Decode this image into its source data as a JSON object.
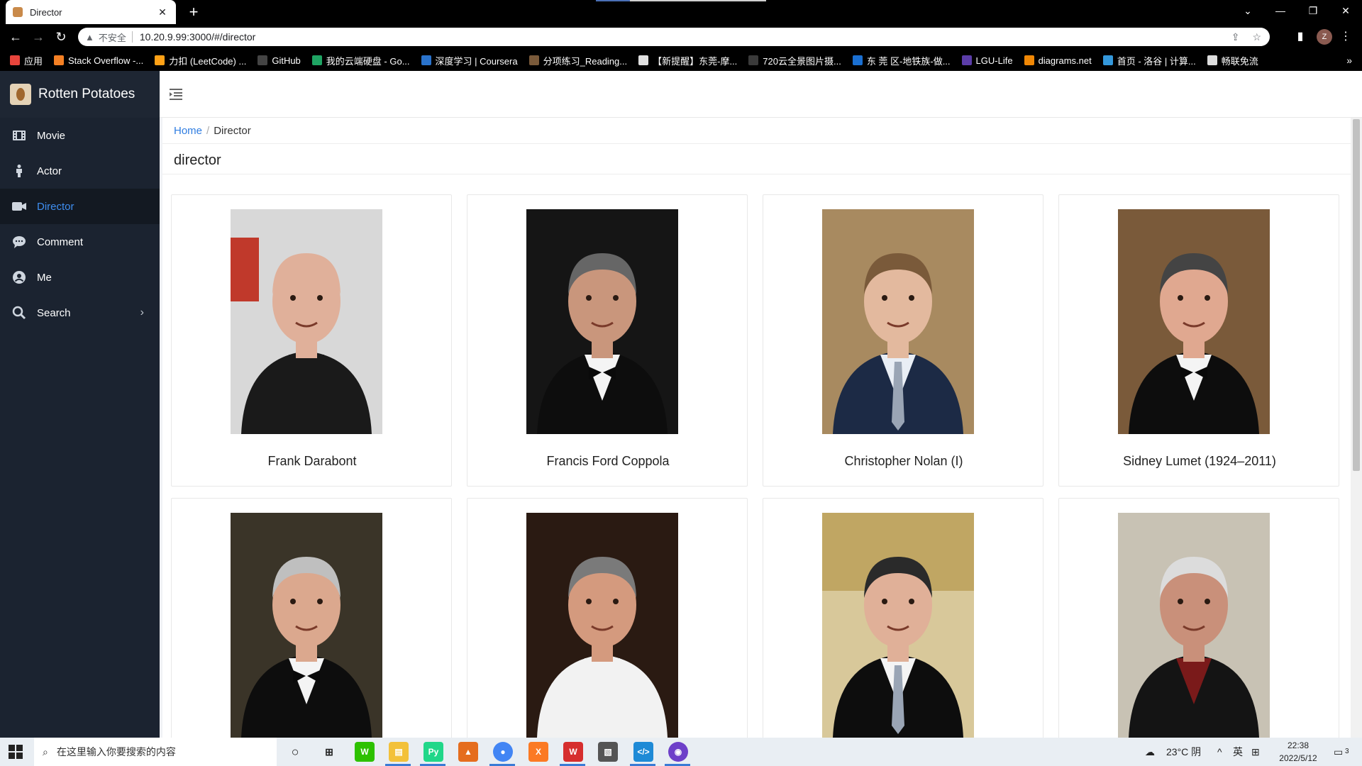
{
  "browser": {
    "tab_title": "Director",
    "insecure_label": "不安全",
    "url": "10.20.9.99:3000/#/director",
    "profile_initial": "Z",
    "bookmarks": [
      {
        "label": "应用",
        "color": "#e8453c"
      },
      {
        "label": "Stack Overflow -...",
        "color": "#f48024"
      },
      {
        "label": "力扣 (LeetCode) ...",
        "color": "#ffa116"
      },
      {
        "label": "GitHub",
        "color": "#444444"
      },
      {
        "label": "我的云端硬盘 - Go...",
        "color": "#1fa463"
      },
      {
        "label": "深度学习 | Coursera",
        "color": "#2a73cc"
      },
      {
        "label": "分项练习_Reading...",
        "color": "#7a5a3a"
      },
      {
        "label": "【新提醒】东莞-摩...",
        "color": "#e0e0e0"
      },
      {
        "label": "720云全景图片摄...",
        "color": "#3a3a3a"
      },
      {
        "label": "东 莞 区-地铁族-做...",
        "color": "#1a6fd1"
      },
      {
        "label": "LGU-Life",
        "color": "#5b3da8"
      },
      {
        "label": "diagrams.net",
        "color": "#f08705"
      },
      {
        "label": "首页 - 洛谷 | 计算...",
        "color": "#3498db"
      },
      {
        "label": "畅联免流",
        "color": "#dddddd"
      }
    ]
  },
  "app": {
    "name": "Rotten Potatoes",
    "menu": [
      {
        "label": "Movie",
        "icon": "film-icon",
        "active": false
      },
      {
        "label": "Actor",
        "icon": "person-icon",
        "active": false
      },
      {
        "label": "Director",
        "icon": "video-camera-icon",
        "active": true
      },
      {
        "label": "Comment",
        "icon": "comment-icon",
        "active": false
      },
      {
        "label": "Me",
        "icon": "user-circle-icon",
        "active": false
      },
      {
        "label": "Search",
        "icon": "search-icon",
        "active": false,
        "has_submenu": true
      }
    ],
    "breadcrumb": {
      "home": "Home",
      "current": "Director"
    },
    "page_title": "director",
    "directors": [
      {
        "name": "Frank Darabont"
      },
      {
        "name": "Francis Ford Coppola"
      },
      {
        "name": "Christopher Nolan (I)"
      },
      {
        "name": "Sidney Lumet (1924–2011)"
      },
      {
        "name": ""
      },
      {
        "name": ""
      },
      {
        "name": ""
      },
      {
        "name": ""
      }
    ]
  },
  "taskbar": {
    "search_placeholder": "在这里输入你要搜索的内容",
    "weather": "23°C 阴",
    "ime": "英",
    "time": "22:38",
    "date": "2022/5/12",
    "notifications": "3"
  },
  "colors": {
    "sidebar_bg": "#1b2330",
    "active_menu": "#3f8ef0",
    "link": "#2f7de1"
  }
}
